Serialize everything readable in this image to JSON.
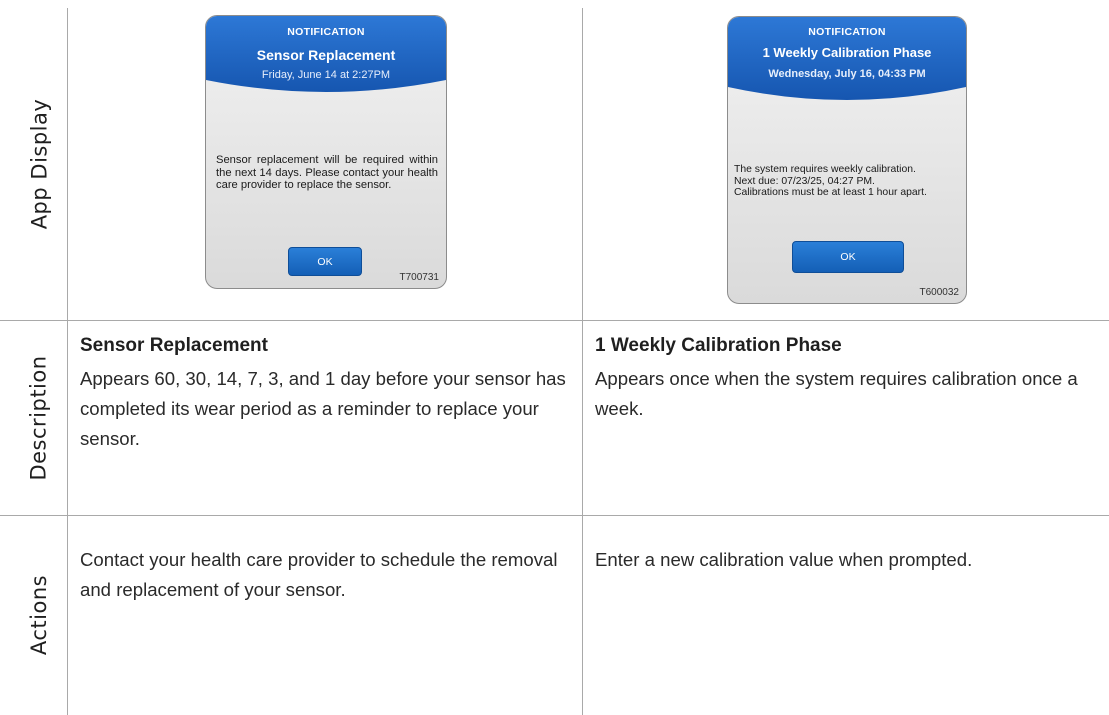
{
  "row_labels": {
    "app_display": "App Display",
    "description": "Description",
    "actions": "Actions"
  },
  "notifications": {
    "left": {
      "kind": "NOTIFICATION",
      "title": "Sensor Replacement",
      "date": "Friday, June 14 at 2:27PM",
      "message": "Sensor replacement will be required within the next 14 days. Please contact your health care provider to replace the sensor.",
      "ok_label": "OK",
      "code": "T700731"
    },
    "right": {
      "kind": "NOTIFICATION",
      "title": "1 Weekly Calibration Phase",
      "date": "Wednesday, July 16, 04:33 PM",
      "message_lines": [
        "The system requires weekly calibration.",
        "Next due: 07/23/25, 04:27 PM.",
        "Calibrations must be at least 1 hour apart."
      ],
      "ok_label": "OK",
      "code": "T600032"
    }
  },
  "description": {
    "left": {
      "title": "Sensor Replacement",
      "body": "Appears 60, 30, 14, 7, 3, and 1 day before your sensor has completed its wear period as a reminder to replace your sensor."
    },
    "right": {
      "title": "1 Weekly Calibration Phase",
      "body": "Appears once when the system requires calibration once a week."
    }
  },
  "actions": {
    "left": "Contact your health care provider to schedule the removal and replacement of your sensor.",
    "right": "Enter a new calibration value when prompted."
  },
  "colors": {
    "header_blue": "#1e66c4",
    "button_blue": "#1a6cc8",
    "grid_line": "#a9a9a9"
  }
}
